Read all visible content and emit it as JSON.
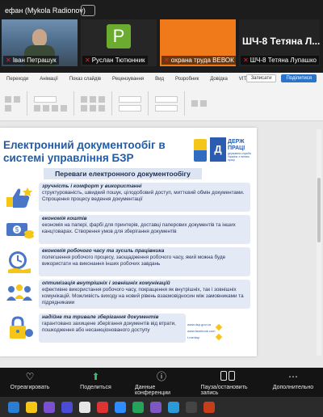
{
  "zoom": {
    "speaker_label": "ефан (Mykola Radionov)",
    "participants": [
      {
        "name": "Іван Петрашук",
        "muted": true
      },
      {
        "name": "Руслан Тютюнник",
        "muted": true,
        "avatar_letter": "P"
      },
      {
        "name": "охрана труда ВЕВОК с",
        "muted": true
      },
      {
        "name": "ШЧ-8 Тетяна Лупашко",
        "muted": true,
        "big_label": "ШЧ-8 Тетяна Л..."
      }
    ],
    "controls": [
      {
        "icon": "chat-icon",
        "label": "Отреагировать"
      },
      {
        "icon": "share-screen-icon",
        "label": "Поделиться"
      },
      {
        "icon": "info-icon",
        "label": "Данные конференции"
      },
      {
        "icon": "pause-record-icon",
        "label": "Пауза/остановить запись"
      },
      {
        "icon": "more-icon",
        "label": "Дополнительно"
      }
    ]
  },
  "ribbon": {
    "tabs": [
      "Переходи",
      "Анімації",
      "Показ слайдів",
      "Рецензування",
      "Вид",
      "Розробник",
      "Довідка",
      "VITALI"
    ],
    "share_label": "Поділитися",
    "record_label": "Записати"
  },
  "slide": {
    "title_line1": "Електронний документообіг в",
    "title_line2": "системі управління БЗР",
    "subtitle": "Переваги електронного документообігу",
    "logo_letter": "Д",
    "logo_text_1": "ДЕРЖ",
    "logo_text_2": "ПРАЦІ",
    "logo_sub": "державна служба України з питань праці",
    "items": [
      {
        "icon": "thumbs-up-icon",
        "head": "зручність і комфорт у використанні",
        "body": "структурованість, швидкий пошук, цілодобовий доступ, миттєвий обмін документами. Спрощення процесу ведення документації"
      },
      {
        "icon": "money-icon",
        "head": "економія коштів",
        "body": "економія на папері, фарбі для принтерів, доставці паперових документів та інших канцтоварах. Створення умов для зберігання документів"
      },
      {
        "icon": "clock-icon",
        "head": "економія робочого часу та зусиль працівника",
        "body": "полегшення робочого процесу, заощадження робочого часу, який можна буде використати на виконання інших робочих завдань"
      },
      {
        "icon": "people-icon",
        "head": "оптимізація внутрішніх і зовнішніх комунікацій",
        "body": "ефективне використання робочого часу, покращення як внутрішніх, так і зовнішніх комунікацій. Можливість виходу на новий рівень взаємовідносин між замовниками та підрядниками"
      },
      {
        "icon": "lock-icon",
        "head": "надійне та тривале зберігання документів",
        "body": "гарантовано захищене зберігання документів від втрати, пошкодження або несанкціонованого доступу"
      }
    ],
    "footer_links": [
      "www.dsp.gov.ua",
      "www.facebook.com",
      "t.me/dsp"
    ]
  }
}
